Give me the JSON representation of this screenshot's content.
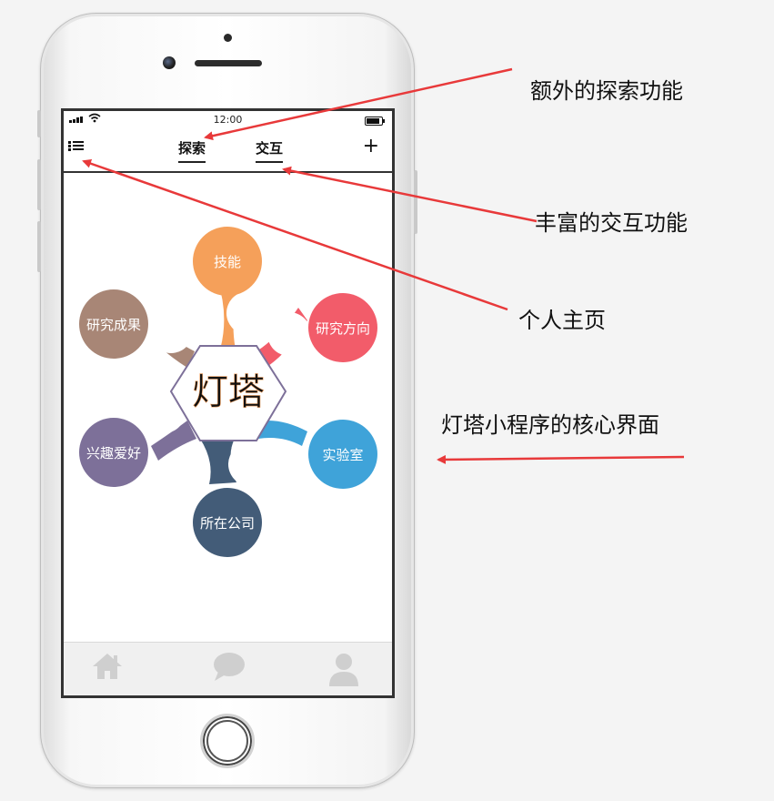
{
  "status_bar": {
    "time": "12:00"
  },
  "nav": {
    "tabs": [
      {
        "label": "探索"
      },
      {
        "label": "交互"
      }
    ],
    "add_label": "+"
  },
  "center": {
    "label": "灯塔"
  },
  "petals": [
    {
      "label": "技能",
      "color": "#f5a05a"
    },
    {
      "label": "研究方向",
      "color": "#f25c6a"
    },
    {
      "label": "实验室",
      "color": "#3fa3d9"
    },
    {
      "label": "所在公司",
      "color": "#435c78"
    },
    {
      "label": "兴趣爱好",
      "color": "#7d7099"
    },
    {
      "label": "研究成果",
      "color": "#a88676"
    }
  ],
  "bottom_nav": [
    {
      "icon": "home-icon"
    },
    {
      "icon": "chat-bubble-icon"
    },
    {
      "icon": "user-icon"
    }
  ],
  "annotations": {
    "extra_explore": "额外的探索功能",
    "rich_interaction": "丰富的交互功能",
    "personal_home": "个人主页",
    "core_interface": "灯塔小程序的核心界面"
  },
  "colors": {
    "arrow": "#e8393a"
  }
}
